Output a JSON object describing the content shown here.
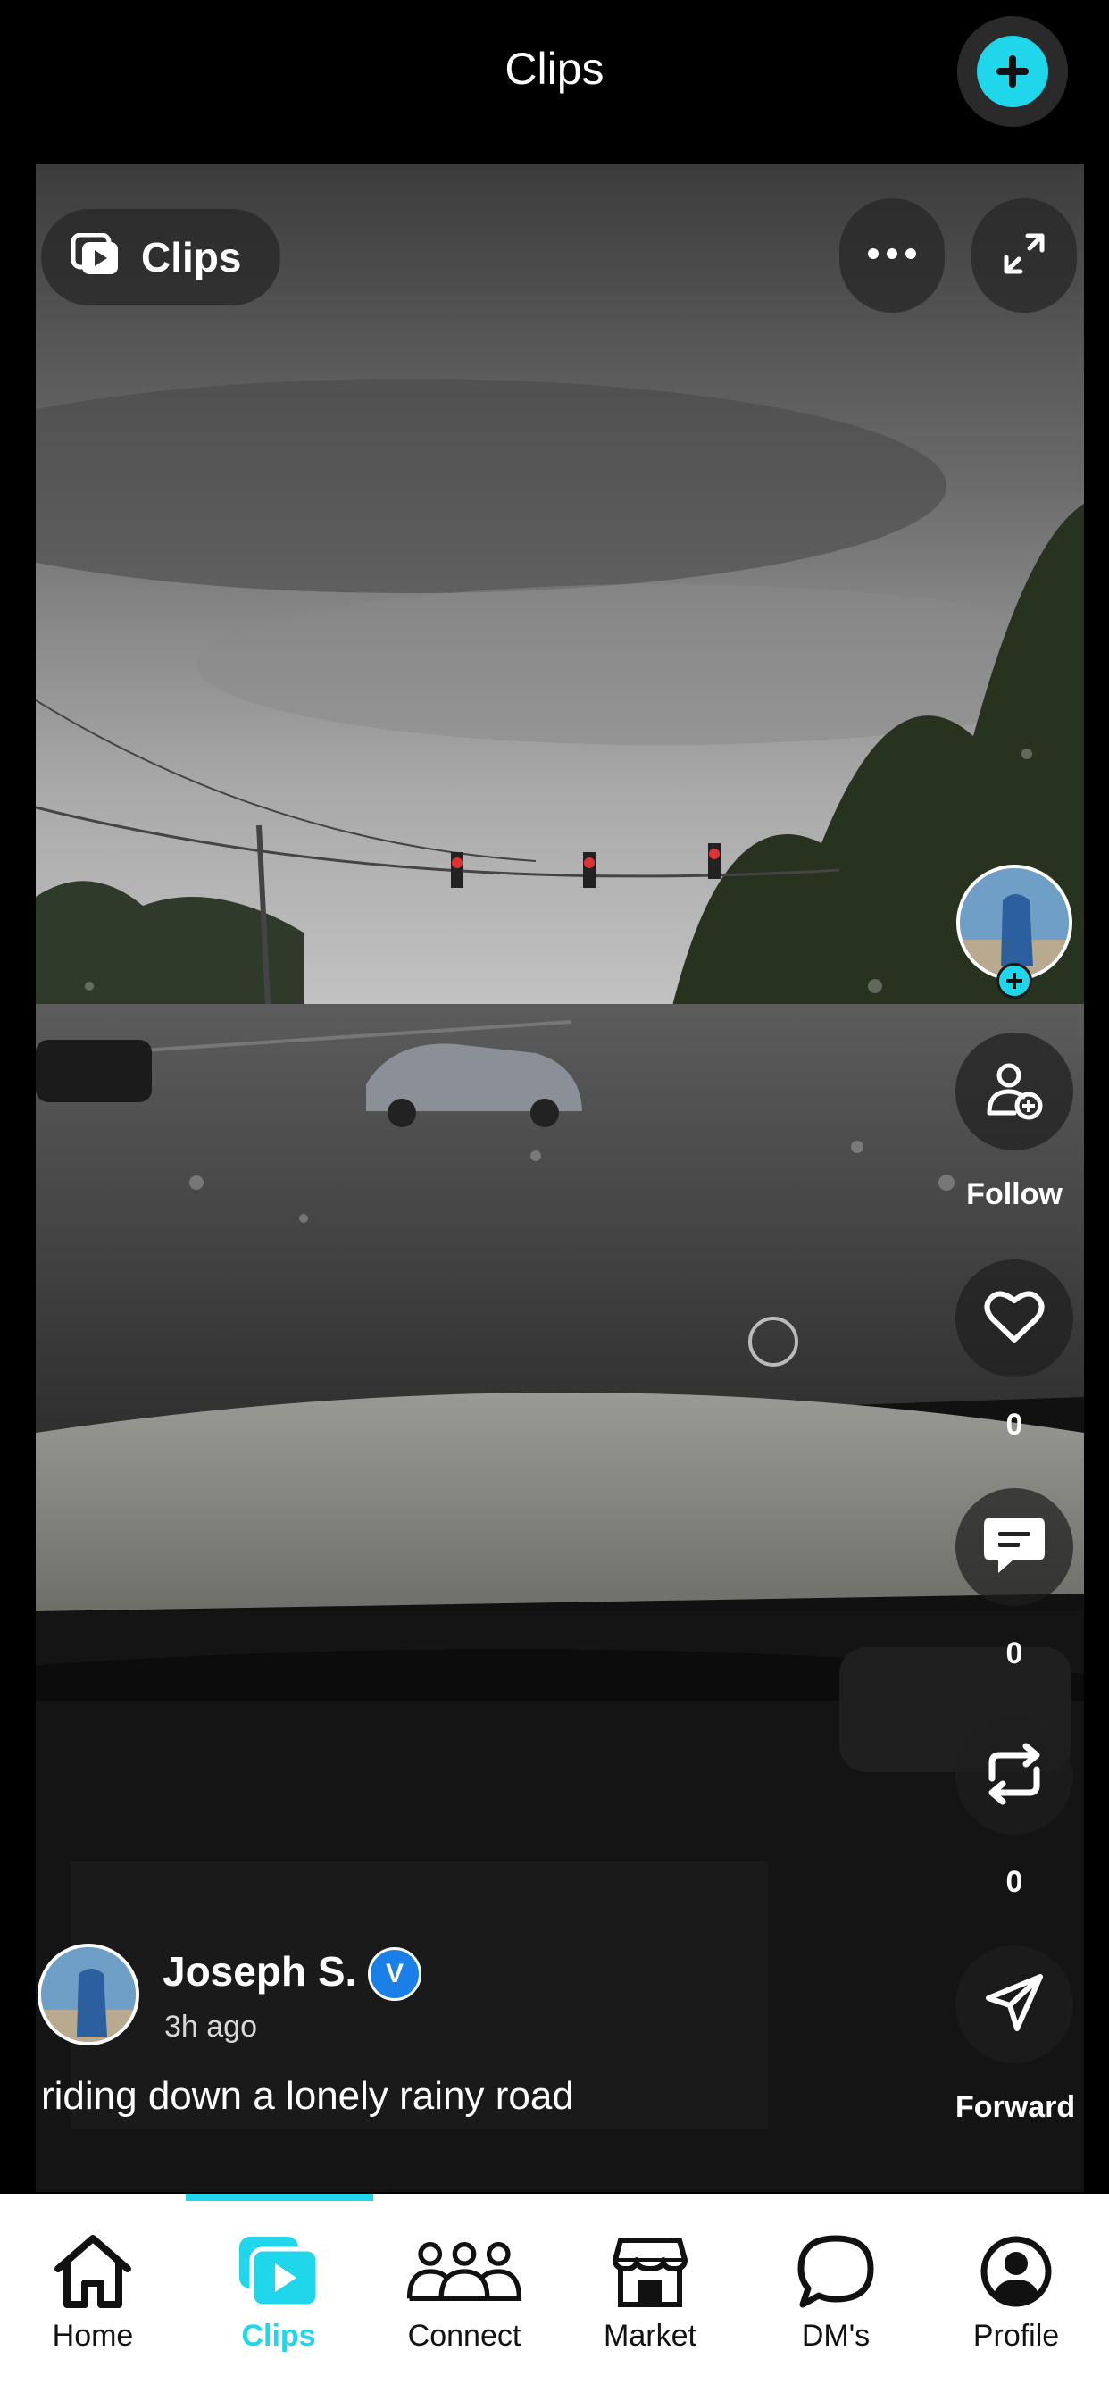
{
  "header": {
    "title": "Clips",
    "add_icon": "plus-circle-icon"
  },
  "video": {
    "badge_label": "Clips",
    "badge_icon": "clips-icon",
    "more_icon": "more-horizontal-icon",
    "expand_icon": "expand-icon"
  },
  "actions": {
    "follow_label": "Follow",
    "like_count": "0",
    "comment_count": "0",
    "repost_count": "0",
    "forward_label": "Forward"
  },
  "post": {
    "author_name": "Joseph S.",
    "verified_letter": "V",
    "time_ago": "3h ago",
    "caption": "riding down a lonely rainy road"
  },
  "nav": {
    "items": [
      {
        "label": "Home",
        "icon": "home-icon"
      },
      {
        "label": "Clips",
        "icon": "clips-icon"
      },
      {
        "label": "Connect",
        "icon": "people-icon"
      },
      {
        "label": "Market",
        "icon": "store-icon"
      },
      {
        "label": "DM's",
        "icon": "chat-bubble-icon"
      },
      {
        "label": "Profile",
        "icon": "profile-icon"
      }
    ],
    "active_index": 1
  },
  "colors": {
    "accent": "#1fd6ea",
    "background": "#000000",
    "nav_bg": "#ffffff"
  }
}
